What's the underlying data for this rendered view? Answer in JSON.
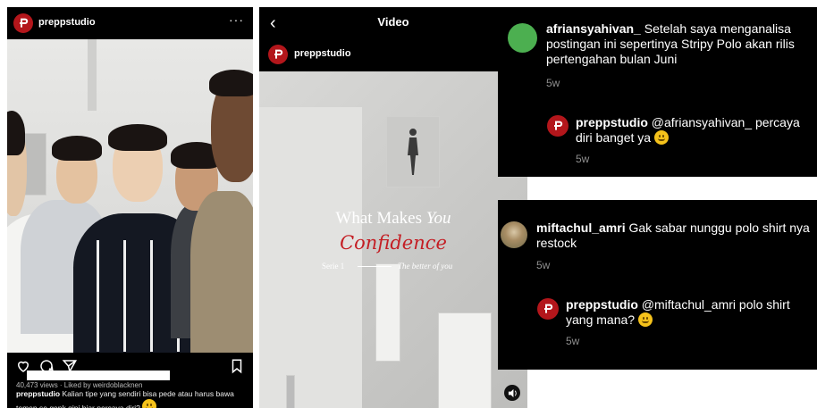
{
  "post": {
    "handle": "preppstudio",
    "more_icon": "more-dots-icon",
    "views_text": "40,473 views · Liked by weirdoblacknen",
    "caption_handle": "preppstudio",
    "caption_text": "Kalian tipe yang sendiri bisa pede atau harus bawa temen se genk gini biar percaya diri?",
    "icons": [
      "heart-icon",
      "comment-icon",
      "send-icon",
      "bookmark-icon"
    ]
  },
  "video": {
    "back_icon": "back-chevron-icon",
    "title": "Video",
    "handle": "preppstudio",
    "line1_prefix": "What Makes ",
    "line1_emph": "You",
    "line2": "Confidence",
    "serie": "Serie 1",
    "tagline": "The better of you",
    "mute_icon": "speaker-icon"
  },
  "comment1": {
    "user": "afriansyahivan_",
    "text": "Setelah saya menganalisa postingan ini sepertinya Stripy Polo akan rilis pertengahan bulan Juni",
    "time": "5w",
    "reply_user": "preppstudio",
    "reply_text": "@afriansyahivan_ percaya diri banget ya",
    "reply_time": "5w",
    "avatar_color": "#4caf50"
  },
  "comment2": {
    "user": "miftachul_amri",
    "text": "Gak sabar nunggu polo shirt nya restock",
    "time": "5w",
    "reply_user": "preppstudio",
    "reply_text": "@miftachul_amri polo shirt yang mana?",
    "reply_time": "5w"
  },
  "colors": {
    "brand": "#b3161b",
    "accent_red": "#c41e24",
    "muted": "#8e8e8e"
  }
}
